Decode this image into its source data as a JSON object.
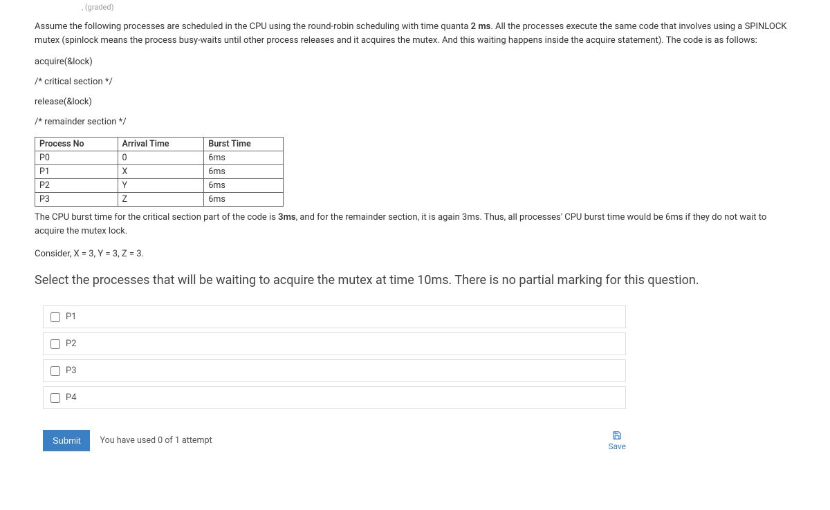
{
  "header": {
    "graded": ", (graded)"
  },
  "prompt": {
    "p1_a": "Assume the following processes are scheduled in the CPU using the round-robin scheduling with time quanta ",
    "p1_bold": "2 ms",
    "p1_b": ". All the processes execute the same code that involves using a SPINLOCK mutex (spinlock means the process busy-waits until other process releases and it acquires the mutex. And this waiting happens inside the acquire statement). The code is as follows:",
    "code1": "acquire(&lock)",
    "code2": "/* critical section */",
    "code3": "release(&lock)",
    "code4": "/* remainder section */"
  },
  "table": {
    "h1": "Process No",
    "h2": "Arrival Time",
    "h3": "Burst Time",
    "rows": [
      {
        "c1": "P0",
        "c2": "0",
        "c3": "6ms"
      },
      {
        "c1": "P1",
        "c2": "X",
        "c3": "6ms"
      },
      {
        "c1": "P2",
        "c2": "Y",
        "c3": "6ms"
      },
      {
        "c1": "P3",
        "c2": "Z",
        "c3": "6ms"
      }
    ]
  },
  "after_table_a": "The CPU burst time for the critical section part of the code is ",
  "after_table_bold": "3ms",
  "after_table_b": ", and for the remainder section, it is again 3ms. Thus, all processes' CPU burst time would be 6ms if they do not wait to acquire the mutex lock.",
  "consider": "Consider, X = 3, Y = 3, Z = 3.",
  "question": "Select the processes that will be waiting to acquire the mutex at time 10ms. There is no partial marking for this question.",
  "options": {
    "o1": "P1",
    "o2": "P2",
    "o3": "P3",
    "o4": "P4"
  },
  "footer": {
    "submit": "Submit",
    "attempts": "You have used 0 of 1 attempt",
    "save": "Save"
  }
}
